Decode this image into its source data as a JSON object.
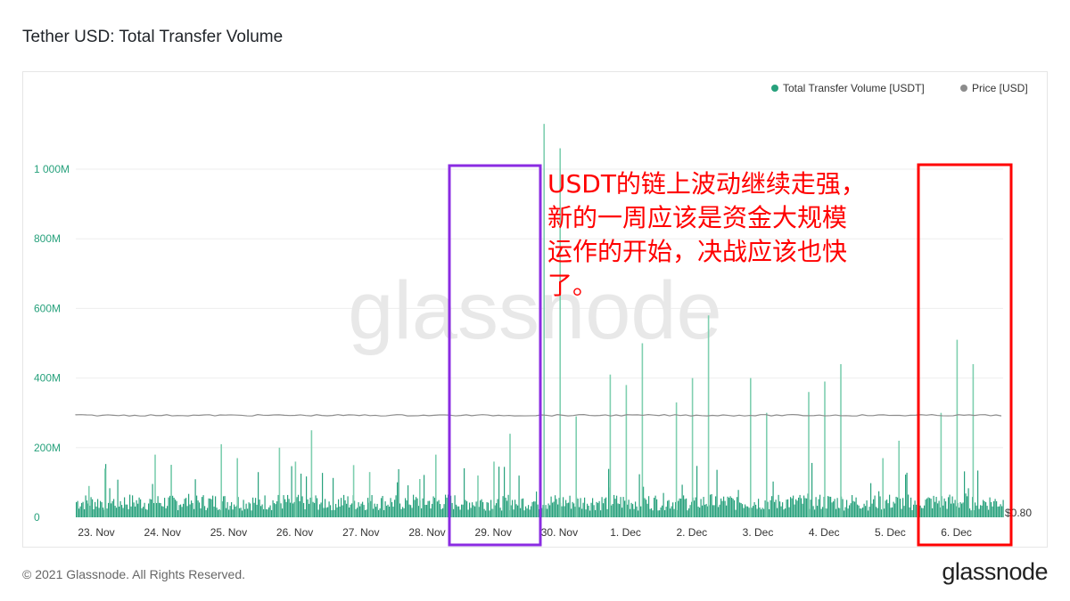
{
  "title": "Tether USD: Total Transfer Volume",
  "footer": {
    "copyright": "© 2021 Glassnode. All Rights Reserved.",
    "logo": "glassnode"
  },
  "watermark": "glassnode",
  "annotation": {
    "lines": [
      "USDT的链上波动继续走强，",
      "新的一周应该是资金大规模",
      "运作的开始，决战应该也快",
      "了。"
    ],
    "color": "#ff0000",
    "box_colors": [
      "#8a2be2",
      "#ff0000"
    ]
  },
  "colors": {
    "volume": "#27a17c",
    "volume_light": "#7fcfb0",
    "price": "#8c8c8c",
    "axis_text": "#27a17c",
    "grid": "#eeeeee"
  },
  "chart_data": {
    "type": "area",
    "title": "Tether USD: Total Transfer Volume",
    "legend_position": "top-right",
    "grid": true,
    "x_ticks": [
      "23. Nov",
      "24. Nov",
      "25. Nov",
      "26. Nov",
      "27. Nov",
      "28. Nov",
      "29. Nov",
      "30. Nov",
      "1. Dec",
      "2. Dec",
      "3. Dec",
      "4. Dec",
      "5. Dec",
      "6. Dec"
    ],
    "y_ticks": [
      "0",
      "200M",
      "400M",
      "600M",
      "800M",
      "1 000M"
    ],
    "y_tick_values": [
      0,
      200,
      400,
      600,
      800,
      1000
    ],
    "ylim": [
      0,
      1130
    ],
    "right_axis_label": "$0.80",
    "series": [
      {
        "name": "Total Transfer Volume [USDT]",
        "unit": "M USDT",
        "baseline": 55,
        "points": [
          [
            "23. Nov",
            90
          ],
          [
            "23. Nov",
            140
          ],
          [
            "24. Nov",
            180
          ],
          [
            "24. Nov",
            150
          ],
          [
            "25. Nov",
            210
          ],
          [
            "25. Nov",
            170
          ],
          [
            "26. Nov",
            200
          ],
          [
            "26. Nov",
            160
          ],
          [
            "26. Nov",
            250
          ],
          [
            "27. Nov",
            150
          ],
          [
            "27. Nov",
            130
          ],
          [
            "28. Nov",
            110
          ],
          [
            "28. Nov",
            180
          ],
          [
            "29. Nov",
            120
          ],
          [
            "29. Nov",
            160
          ],
          [
            "29. Nov",
            240
          ],
          [
            "30. Nov",
            1130
          ],
          [
            "30. Nov",
            1060
          ],
          [
            "30. Nov",
            290
          ],
          [
            "1. Dec",
            410
          ],
          [
            "1. Dec",
            380
          ],
          [
            "1. Dec",
            500
          ],
          [
            "2. Dec",
            330
          ],
          [
            "2. Dec",
            400
          ],
          [
            "2. Dec",
            580
          ],
          [
            "3. Dec",
            400
          ],
          [
            "3. Dec",
            300
          ],
          [
            "4. Dec",
            360
          ],
          [
            "4. Dec",
            390
          ],
          [
            "4. Dec",
            440
          ],
          [
            "5. Dec",
            170
          ],
          [
            "5. Dec",
            220
          ],
          [
            "6. Dec",
            300
          ],
          [
            "6. Dec",
            510
          ],
          [
            "6. Dec",
            440
          ]
        ]
      },
      {
        "name": "Price [USD]",
        "unit": "USD",
        "value_level_on_volume_axis": 293
      }
    ]
  }
}
